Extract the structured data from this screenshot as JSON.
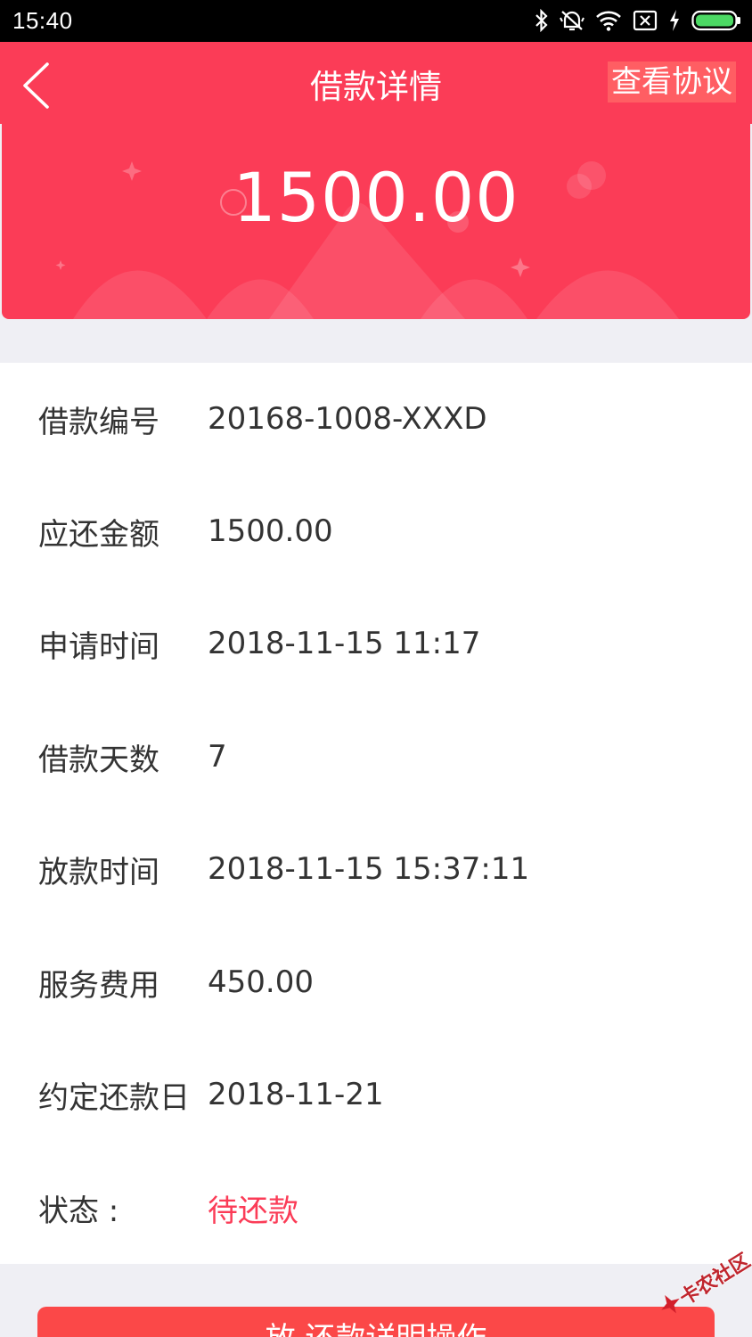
{
  "status_bar": {
    "time": "15:40",
    "icons": [
      "bluetooth-icon",
      "mute-vibrate-icon",
      "wifi-icon",
      "sim-blocked-icon",
      "charging-icon",
      "battery-icon"
    ]
  },
  "nav": {
    "title": "借款详情",
    "agreement_link": "查看协议",
    "back_icon": "chevron-left-icon"
  },
  "hero": {
    "amount": "1500.00"
  },
  "details": [
    {
      "label": "借款编号",
      "value": "20168-1008-XXXD"
    },
    {
      "label": "应还金额",
      "value": "1500.00"
    },
    {
      "label": "申请时间",
      "value": "2018-11-15 11:17"
    },
    {
      "label": "借款天数",
      "value": "7"
    },
    {
      "label": "放款时间",
      "value": "2018-11-15 15:37:11"
    },
    {
      "label": "服务费用",
      "value": "450.00"
    },
    {
      "label": "约定还款日",
      "value": "2018-11-21"
    },
    {
      "label": "状态 :",
      "value": "待还款"
    }
  ],
  "action_button": {
    "label": "放  还款详明操作"
  },
  "watermark": {
    "text": "卡农社区"
  },
  "colors": {
    "brand_red": "#fb3c57",
    "button_red": "#fb4848",
    "status_pending": "#fb3c57",
    "background": "#efeff4"
  }
}
